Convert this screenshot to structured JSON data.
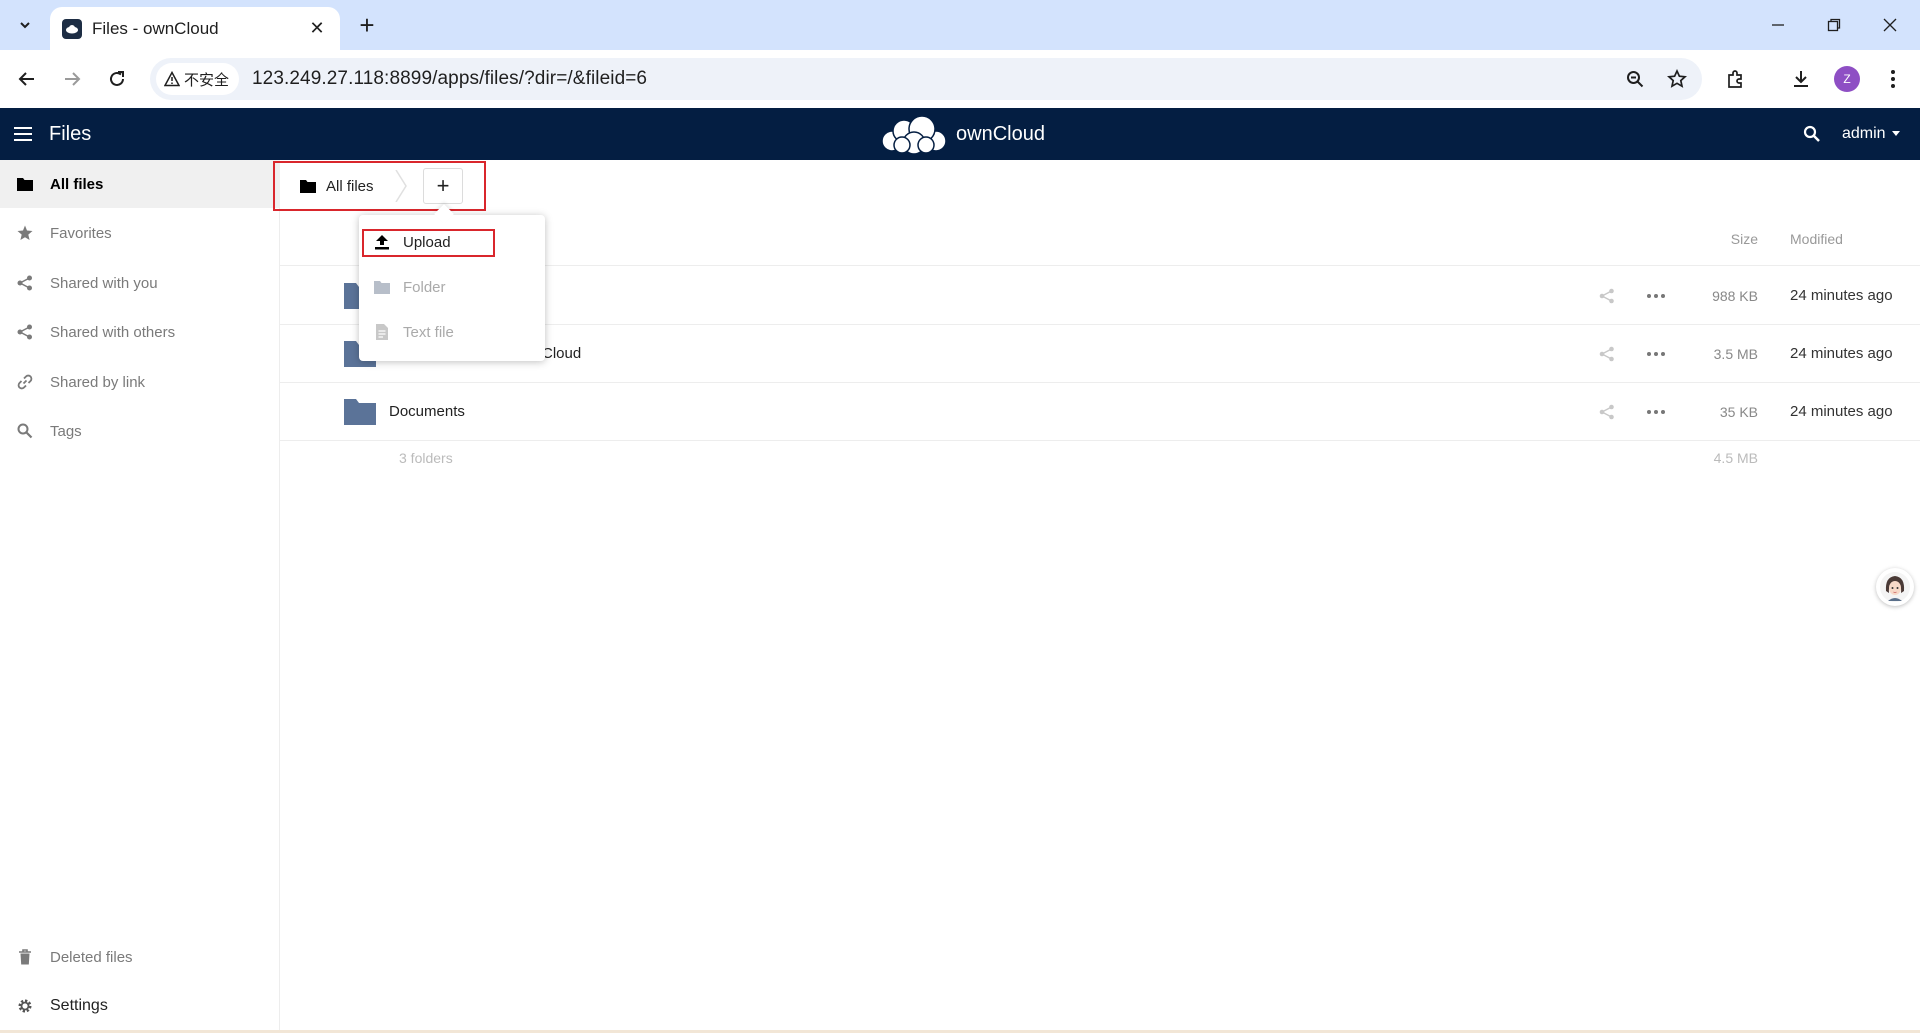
{
  "browser": {
    "tab_title": "Files - ownCloud",
    "security_label": "不安全",
    "url": "123.249.27.118:8899/apps/files/?dir=/&fileid=6",
    "profile_initial": "Z"
  },
  "header": {
    "app_name": "Files",
    "brand": "ownCloud",
    "user": "admin"
  },
  "sidebar": {
    "items": [
      {
        "label": "All files",
        "icon": "folder-icon"
      },
      {
        "label": "Favorites",
        "icon": "star-icon"
      },
      {
        "label": "Shared with you",
        "icon": "share-icon"
      },
      {
        "label": "Shared with others",
        "icon": "share-icon"
      },
      {
        "label": "Shared by link",
        "icon": "link-icon"
      },
      {
        "label": "Tags",
        "icon": "search-icon"
      }
    ],
    "deleted_files": "Deleted files",
    "settings": "Settings"
  },
  "breadcrumb": {
    "home": "All files",
    "new_button": "+"
  },
  "new_menu": {
    "items": [
      "Upload",
      "Folder",
      "Text file"
    ]
  },
  "file_list": {
    "columns": {
      "size": "Size",
      "modified": "Modified"
    },
    "rows": [
      {
        "name": "",
        "size": "988 KB",
        "modified": "24 minutes ago"
      },
      {
        "name": "Cloud",
        "size": "3.5 MB",
        "modified": "24 minutes ago"
      },
      {
        "name": "Documents",
        "size": "35 KB",
        "modified": "24 minutes ago"
      }
    ],
    "summary": {
      "count": "3 folders",
      "size": "4.5 MB"
    }
  },
  "colors": {
    "header_bg": "#041e42",
    "folder": "#5b7398",
    "highlight": "#d9262c"
  }
}
